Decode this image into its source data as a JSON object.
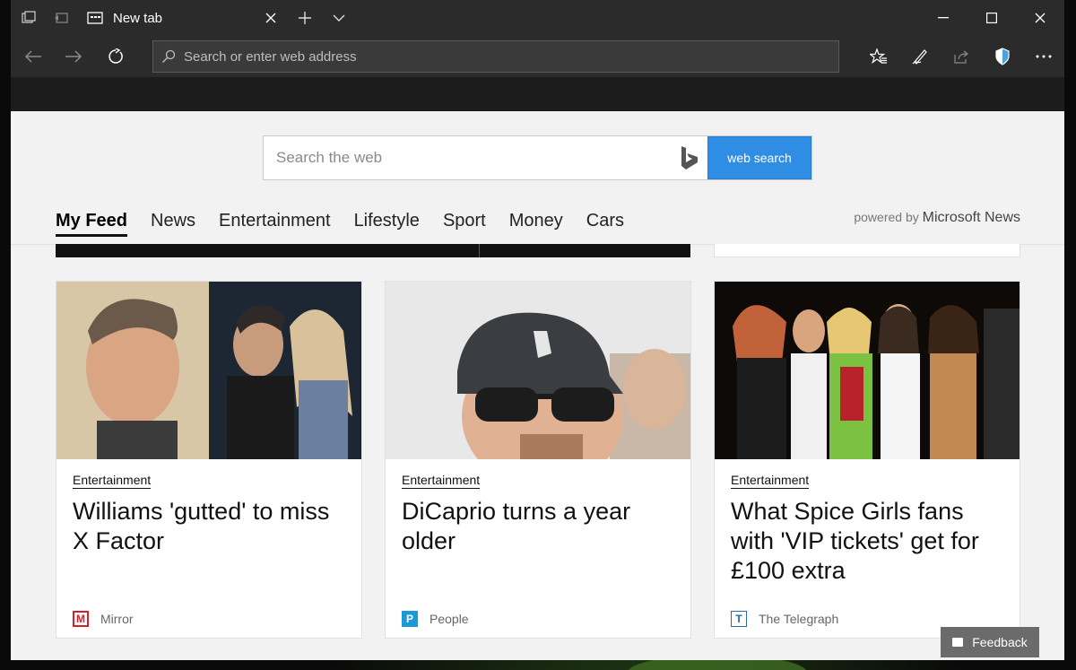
{
  "window": {
    "tab_title": "New tab"
  },
  "addressbar": {
    "placeholder": "Search or enter web address"
  },
  "search": {
    "placeholder": "Search the web",
    "button_label": "web search"
  },
  "feed": {
    "tabs": [
      "My Feed",
      "News",
      "Entertainment",
      "Lifestyle",
      "Sport",
      "Money",
      "Cars"
    ],
    "active_tab": "My Feed",
    "powered_prefix": "powered by",
    "powered_brand": "Microsoft News"
  },
  "cards": [
    {
      "category": "Entertainment",
      "headline": "Williams 'gutted' to miss X Factor",
      "source": "Mirror",
      "source_logo_letter": "M",
      "source_color": "#d61f26"
    },
    {
      "category": "Entertainment",
      "headline": "DiCaprio turns a year older",
      "source": "People",
      "source_logo_letter": "P",
      "source_color": "#1c9ad6"
    },
    {
      "category": "Entertainment",
      "headline": "What Spice Girls fans with 'VIP tickets' get for £100 extra",
      "source": "The Telegraph",
      "source_logo_letter": "T",
      "source_color": "#2b6aa3"
    }
  ],
  "feedback": {
    "label": "Feedback"
  },
  "colors": {
    "accent": "#2f8ee3",
    "chrome": "#2b2b2b"
  }
}
